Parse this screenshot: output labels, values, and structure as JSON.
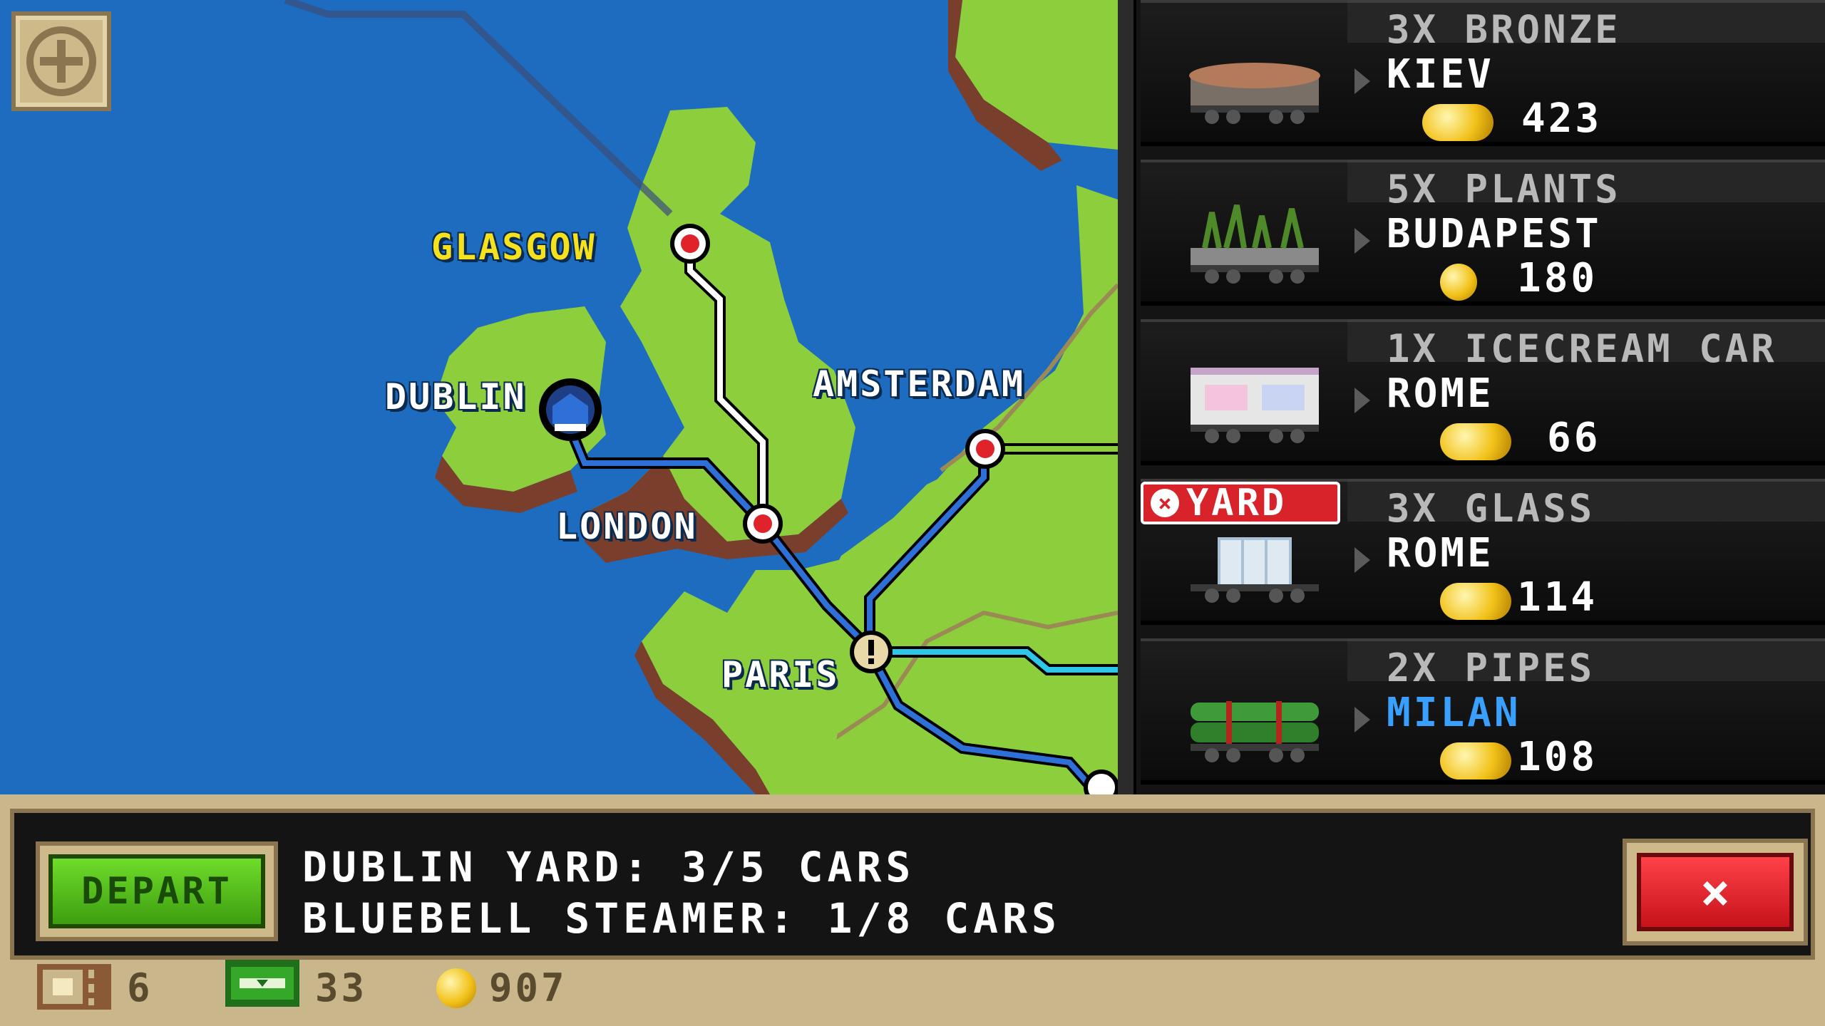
{
  "map": {
    "cities": [
      {
        "name": "GLASGOW",
        "highlight": true
      },
      {
        "name": "DUBLIN",
        "highlight": false
      },
      {
        "name": "AMSTERDAM",
        "highlight": false
      },
      {
        "name": "LONDON",
        "highlight": false
      },
      {
        "name": "PARIS",
        "highlight": false
      }
    ],
    "zoom_icon": "plus-icon"
  },
  "orders": [
    {
      "cargo": "3X BRONZE",
      "city": "KIEV",
      "reward": "423",
      "coin_icon": "coin-stack-icon",
      "car_icon": "ore-car-icon"
    },
    {
      "cargo": "5X PLANTS",
      "city": "BUDAPEST",
      "reward": "180",
      "coin_icon": "coin-icon",
      "car_icon": "plant-car-icon"
    },
    {
      "cargo": "1X ICECREAM CAR",
      "city": "ROME",
      "reward": "66",
      "coin_icon": "coin-stack-icon",
      "car_icon": "icecream-car-icon"
    },
    {
      "cargo": "3X GLASS",
      "city": "ROME",
      "reward": "114",
      "coin_icon": "coin-stack-icon",
      "car_icon": "glass-car-icon",
      "badge": "YARD",
      "badge_icon": "x-icon"
    },
    {
      "cargo": "2X PIPES",
      "city": "MILAN",
      "reward": "108",
      "coin_icon": "coin-stack-icon",
      "car_icon": "pipe-car-icon"
    }
  ],
  "bottom": {
    "depart_label": "DEPART",
    "yard_line": "DUBLIN YARD: 3/5 CARS",
    "train_line": "BLUEBELL STEAMER: 1/8 CARS",
    "close_label": "×",
    "close_icon": "close-icon"
  },
  "stats": {
    "tickets": "6",
    "cash": "33",
    "coins": "907"
  },
  "colors": {
    "sea": "#1f6fc4",
    "land": "#8cce3c",
    "accent_yellow": "#f5e11e",
    "milan_blue": "#3aa0ff",
    "depart_green": "#4fb81a",
    "close_red": "#e0222a"
  }
}
